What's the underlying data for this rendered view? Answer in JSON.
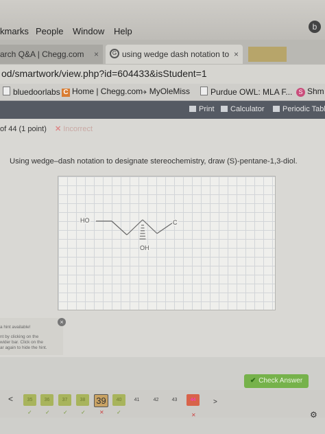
{
  "menubar": {
    "items": [
      "kmarks",
      "People",
      "Window",
      "Help"
    ]
  },
  "tabs": [
    {
      "title": "arch Q&A | Chegg.com"
    },
    {
      "title": "using wedge dash notation to"
    }
  ],
  "address": "od/smartwork/view.php?id=604433&isStudent=1",
  "bookmarks": [
    "bluedoorlabs",
    "Home | Chegg.com",
    "MyOleMiss",
    "Purdue OWL: MLA F...",
    "Shm"
  ],
  "toolbar": {
    "print": "Print",
    "calculator": "Calculator",
    "periodic": "Periodic Tabl"
  },
  "question": {
    "progress": "of 44 (1 point)",
    "status": "Incorrect",
    "prompt": "Using wedge–dash notation to designate stereochemistry, draw (S)-pentane-1,3-diol."
  },
  "molecule": {
    "atoms": [
      "HO",
      "C",
      "OH"
    ]
  },
  "hint": {
    "lines": [
      "a hint available!",
      "nt by clicking on the",
      "wider bar. Click on the",
      "ar again to hide the hint."
    ]
  },
  "check_answer": "Check Answer",
  "navigation": {
    "questions": [
      {
        "label": "35",
        "state": "done"
      },
      {
        "label": "36",
        "state": "done"
      },
      {
        "label": "37",
        "state": "done"
      },
      {
        "label": "38",
        "state": "done"
      },
      {
        "label": "39",
        "state": "cur"
      },
      {
        "label": "40",
        "state": "done"
      },
      {
        "label": "41",
        "state": "plain"
      },
      {
        "label": "42",
        "state": "plain"
      },
      {
        "label": "43",
        "state": "plain"
      },
      {
        "label": "44",
        "state": "red"
      }
    ],
    "prev": "<",
    "next": ">"
  }
}
